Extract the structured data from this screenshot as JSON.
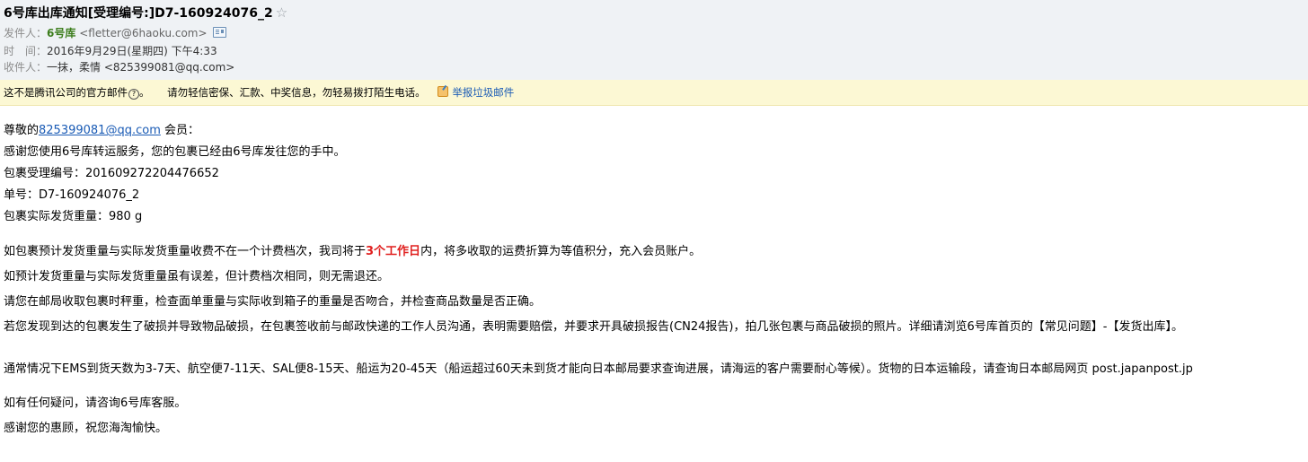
{
  "header": {
    "subject": "6号库出库通知[受理编号:]D7-160924076_2",
    "star_glyph": "☆",
    "from_label": "发件人：",
    "from_name": "6号库",
    "from_addr": "<fletter@6haoku.com>",
    "time_label": "时　间：",
    "time_value": "2016年9月29日(星期四) 下午4:33",
    "to_label": "收件人：",
    "to_value": "一抹，柔情 <825399081@qq.com>"
  },
  "warning": {
    "not_official": "这不是腾讯公司的官方邮件",
    "q_glyph": "?",
    "tip": "请勿轻信密保、汇款、中奖信息，勿轻易拨打陌生电话。",
    "report_link": "举报垃圾邮件"
  },
  "body": {
    "greeting_prefix": "尊敬的",
    "greeting_email": "825399081@qq.com",
    "greeting_suffix": " 会员：",
    "thanks": "感谢您使用6号库转运服务，您的包裹已经由6号库发往您的手中。",
    "accept_no": "包裹受理编号：201609272204476652",
    "order_no": "单号：D7-160924076_2",
    "weight": "包裹实际发货重量：980 g",
    "p1_before": "如包裹预计发货重量与实际发货重量收费不在一个计费档次，我司将于",
    "p1_red": "3个工作日",
    "p1_after": "内，将多收取的运费折算为等值积分，充入会员账户。",
    "p2": "如预计发货重量与实际发货重量虽有误差，但计费档次相同，则无需退还。",
    "p3": "请您在邮局收取包裹时秤重，检查面单重量与实际收到箱子的重量是否吻合，并检查商品数量是否正确。",
    "p4": "若您发现到达的包裹发生了破损并导致物品破损，在包裹签收前与邮政快递的工作人员沟通，表明需要赔偿，并要求开具破损报告(CN24报告)，拍几张包裹与商品破损的照片。详细请浏览6号库首页的【常见问题】-【发货出库】。",
    "p5": "通常情况下EMS到货天数为3-7天、航空便7-11天、SAL便8-15天、船运为20-45天（船运超过60天未到货才能向日本邮局要求查询进展，请海运的客户需要耐心等候）。货物的日本运输段，请查询日本邮局网页 post.japanpost.jp",
    "p6": "如有任何疑问，请咨询6号库客服。",
    "p7": "感谢您的惠顾，祝您海淘愉快。"
  }
}
